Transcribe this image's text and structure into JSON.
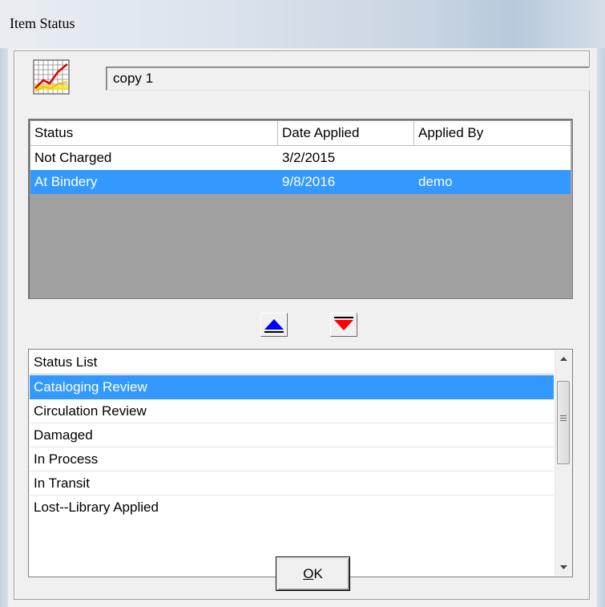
{
  "window": {
    "title": "Item Status"
  },
  "copy_field": {
    "value": "copy 1",
    "icon": "chart-icon"
  },
  "status_grid": {
    "columns": [
      "Status",
      "Date Applied",
      "Applied By"
    ],
    "rows": [
      {
        "status": "Not Charged",
        "date": "3/2/2015",
        "by": ""
      },
      {
        "status": "At Bindery",
        "date": "9/8/2016",
        "by": "demo",
        "selected": true
      }
    ]
  },
  "move_buttons": {
    "up_icon": "up-arrow-icon",
    "down_icon": "down-arrow-icon",
    "up_color": "#0000ff",
    "down_color": "#ff0000"
  },
  "status_list": {
    "header": "Status List",
    "items": [
      {
        "label": "Cataloging Review",
        "selected": true
      },
      {
        "label": "Circulation Review"
      },
      {
        "label": "Damaged"
      },
      {
        "label": "In Process"
      },
      {
        "label": "In Transit"
      },
      {
        "label": "Lost--Library Applied"
      }
    ]
  },
  "ok_button": {
    "label": "OK"
  },
  "colors": {
    "selection": "#3399ff"
  }
}
